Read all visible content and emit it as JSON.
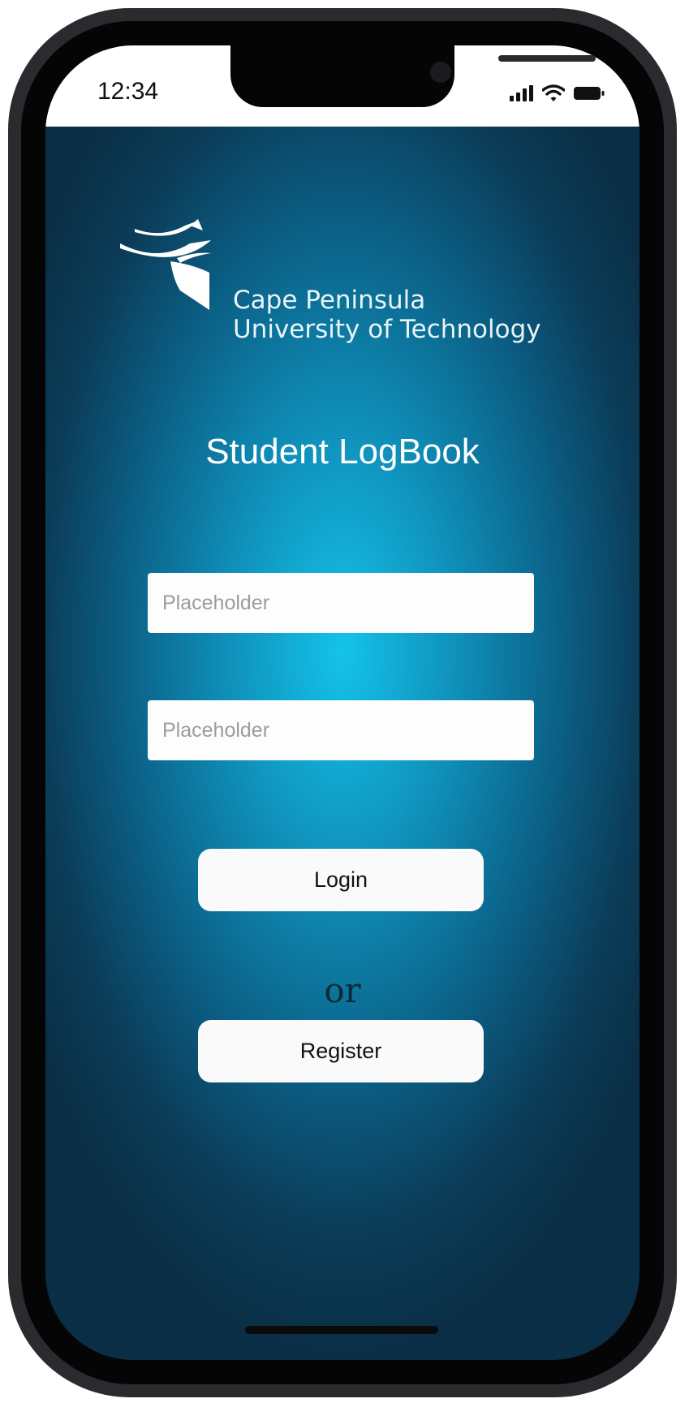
{
  "status_bar": {
    "time": "12:34",
    "icons": [
      "cellular-signal-icon",
      "wifi-icon",
      "battery-icon"
    ]
  },
  "logo": {
    "icon": "cput-logo-icon",
    "line1": "Cape Peninsula",
    "line2": "University of Technology"
  },
  "title": "Student LogBook",
  "form": {
    "field1_placeholder": "Placeholder",
    "field2_placeholder": "Placeholder",
    "login_label": "Login",
    "or_text": "or",
    "register_label": "Register"
  },
  "colors": {
    "background_center": "#14c3ea",
    "background_edge": "#0a2e45",
    "button_bg": "#fafafa",
    "or_text": "#0b2a38"
  }
}
